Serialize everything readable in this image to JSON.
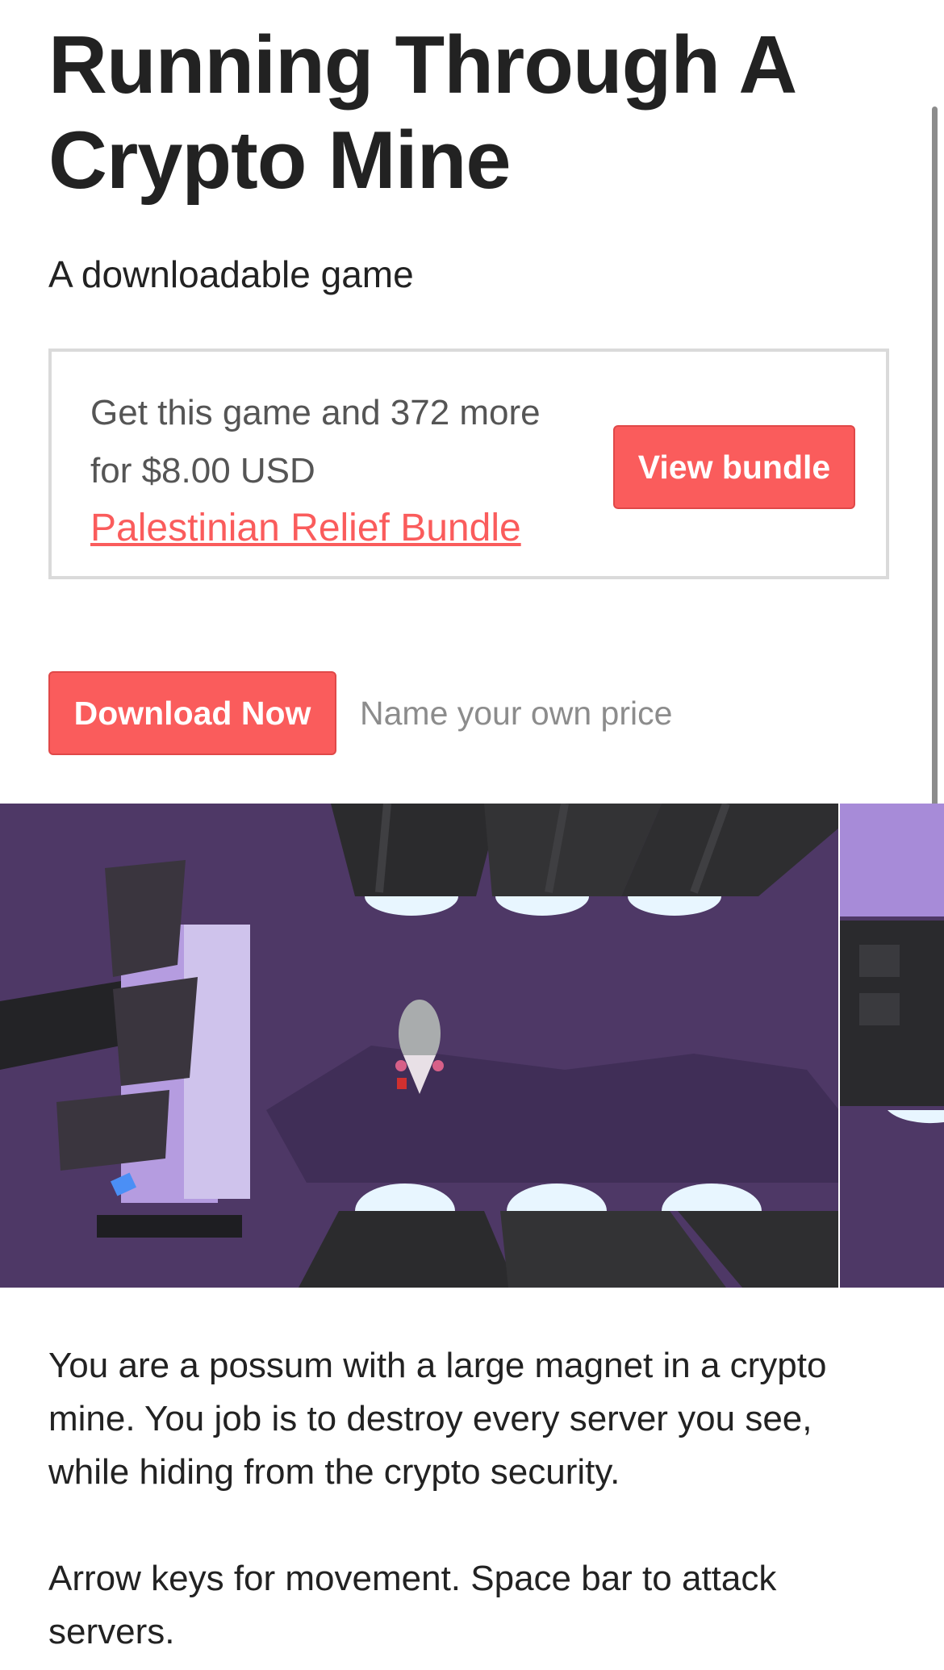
{
  "game": {
    "title": "Running Through A Crypto Mine",
    "subtitle": "A downloadable game"
  },
  "bundle": {
    "text": "Get this game and 372 more for $8.00 USD",
    "link_label": "Palestinian Relief Bundle",
    "button_label": "View bundle"
  },
  "purchase": {
    "download_label": "Download Now",
    "price_text": "Name your own price"
  },
  "description": {
    "paragraph1": "You are a possum with a large magnet in a crypto mine.  You job is to destroy every server you see, while hiding from the crypto security.",
    "paragraph2": "Arrow keys for movement.  Space bar to attack servers."
  },
  "colors": {
    "accent": "#fa5c5c",
    "text": "#222222",
    "muted": "#8c8c8c",
    "game_floor": "#4e3866"
  }
}
